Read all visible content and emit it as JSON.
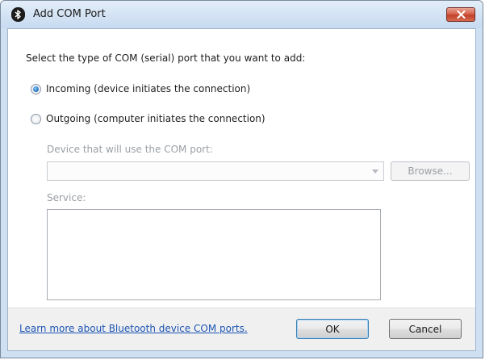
{
  "window": {
    "title": "Add COM Port",
    "icon": "bluetooth-icon"
  },
  "dialog": {
    "instruction": "Select the type of COM (serial) port that you want to add:",
    "options": [
      {
        "label": "Incoming (device initiates the connection)",
        "checked": true
      },
      {
        "label": "Outgoing (computer initiates the connection)",
        "checked": false
      }
    ],
    "device_label": "Device that will use the COM port:",
    "device_value": "",
    "browse_label": "Browse...",
    "service_label": "Service:",
    "service_items": []
  },
  "footer": {
    "help_link": "Learn more about Bluetooth device COM ports.",
    "ok_label": "OK",
    "cancel_label": "Cancel"
  },
  "colors": {
    "link": "#1d55b4",
    "close_button": "#c2402a",
    "disabled_text": "#9aa0a6"
  }
}
